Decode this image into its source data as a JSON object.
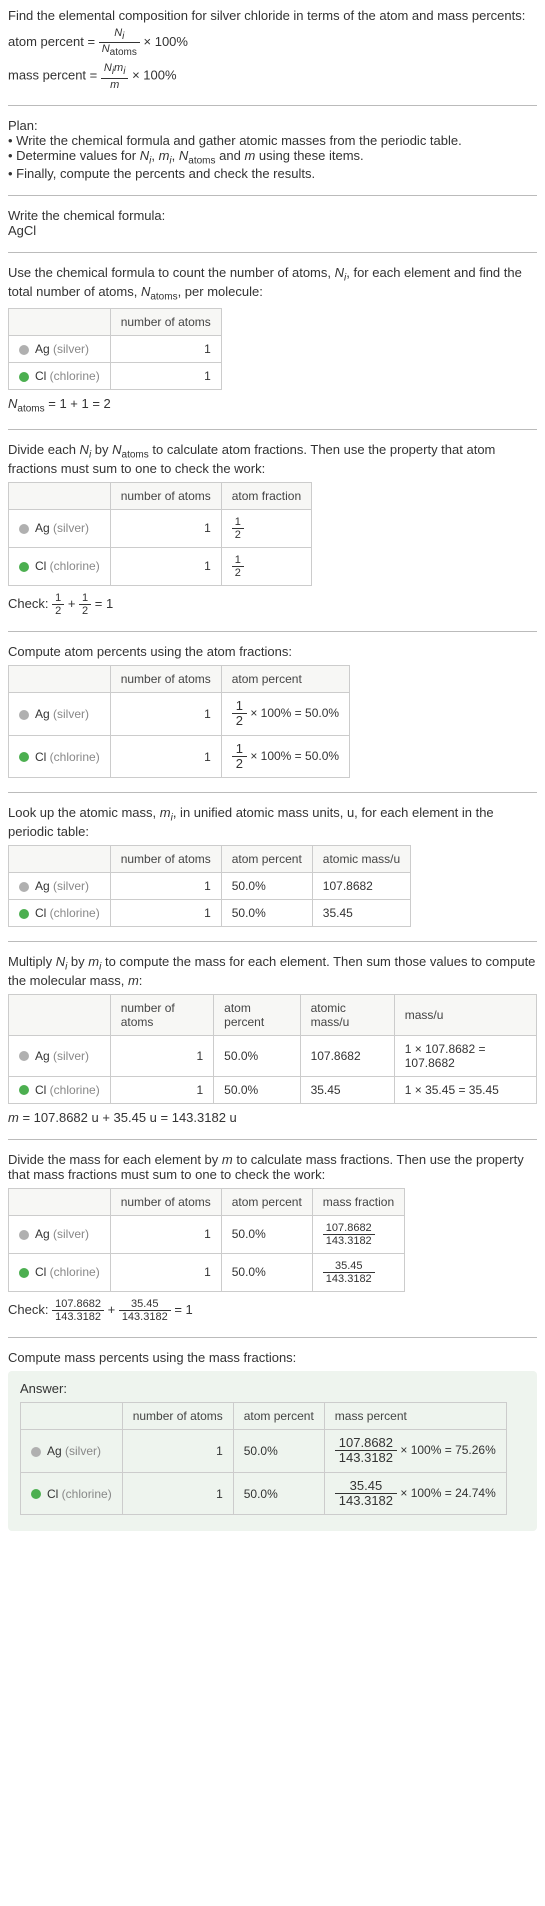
{
  "intro": {
    "prompt": "Find the elemental composition for silver chloride in terms of the atom and mass percents:",
    "atom_percent_lhs": "atom percent = ",
    "atom_percent_num": "N",
    "atom_percent_num_sub": "i",
    "atom_percent_den": "N",
    "atom_percent_den_sub": "atoms",
    "times100": " × 100%",
    "mass_percent_lhs": "mass percent = ",
    "mass_percent_num_a": "N",
    "mass_percent_num_a_sub": "i",
    "mass_percent_num_b": "m",
    "mass_percent_num_b_sub": "i",
    "mass_percent_den": "m"
  },
  "plan": {
    "heading": "Plan:",
    "b1": "• Write the chemical formula and gather atomic masses from the periodic table.",
    "b2_pre": "• Determine values for ",
    "b2_n": "N",
    "b2_ni": "i",
    "b2_m": "m",
    "b2_mi": "i",
    "b2_na": "N",
    "b2_na_sub": "atoms",
    "b2_and": " and ",
    "b2_m2": "m",
    "b2_post": " using these items.",
    "b3": "• Finally, compute the percents and check the results."
  },
  "step_formula": {
    "heading": "Write the chemical formula:",
    "formula": "AgCl"
  },
  "step_count": {
    "text_a": "Use the chemical formula to count the number of atoms, ",
    "n": "N",
    "n_sub": "i",
    "text_b": ", for each element and find the total number of atoms, ",
    "na": "N",
    "na_sub": "atoms",
    "text_c": ", per molecule:",
    "col_num": "number of atoms",
    "ag_label": "Ag",
    "ag_paren": " (silver)",
    "ag_n": "1",
    "cl_label": "Cl",
    "cl_paren": " (chlorine)",
    "cl_n": "1",
    "sum_lhs_a": "N",
    "sum_lhs_sub": "atoms",
    "sum_eq": " = 1 + 1 = 2"
  },
  "step_atomfrac": {
    "text_a": "Divide each ",
    "n": "N",
    "n_sub": "i",
    "text_b": " by ",
    "na": "N",
    "na_sub": "atoms",
    "text_c": " to calculate atom fractions. Then use the property that atom fractions must sum to one to check the work:",
    "col_num": "number of atoms",
    "col_af": "atom fraction",
    "ag_n": "1",
    "ag_frac_num": "1",
    "ag_frac_den": "2",
    "cl_n": "1",
    "cl_frac_num": "1",
    "cl_frac_den": "2",
    "check_pre": "Check: ",
    "check_eq": " = 1"
  },
  "step_atompct": {
    "heading": "Compute atom percents using the atom fractions:",
    "col_num": "number of atoms",
    "col_ap": "atom percent",
    "ag_n": "1",
    "ag_frac_num": "1",
    "ag_frac_den": "2",
    "ag_pct": " × 100% = 50.0%",
    "cl_n": "1",
    "cl_frac_num": "1",
    "cl_frac_den": "2",
    "cl_pct": " × 100% = 50.0%"
  },
  "step_mass_lookup": {
    "text_a": "Look up the atomic mass, ",
    "m": "m",
    "m_sub": "i",
    "text_b": ", in unified atomic mass units, u, for each element in the periodic table:",
    "col_num": "number of atoms",
    "col_ap": "atom percent",
    "col_am": "atomic mass/u",
    "ag_n": "1",
    "ag_ap": "50.0%",
    "ag_am": "107.8682",
    "cl_n": "1",
    "cl_ap": "50.0%",
    "cl_am": "35.45"
  },
  "step_mass_mult": {
    "text_a": "Multiply ",
    "n": "N",
    "n_sub": "i",
    "text_b": " by ",
    "m": "m",
    "m_sub": "i",
    "text_c": " to compute the mass for each element. Then sum those values to compute the molecular mass, ",
    "mm": "m",
    "text_d": ":",
    "col_num": "number of atoms",
    "col_ap": "atom percent",
    "col_am": "atomic mass/u",
    "col_mass": "mass/u",
    "ag_n": "1",
    "ag_ap": "50.0%",
    "ag_am": "107.8682",
    "ag_mass": "1 × 107.8682 = 107.8682",
    "cl_n": "1",
    "cl_ap": "50.0%",
    "cl_am": "35.45",
    "cl_mass": "1 × 35.45 = 35.45",
    "sum_m": "m",
    "sum_eq": " = 107.8682 u + 35.45 u = 143.3182 u"
  },
  "step_massfrac": {
    "text_a": "Divide the mass for each element by ",
    "m": "m",
    "text_b": " to calculate mass fractions. Then use the property that mass fractions must sum to one to check the work:",
    "col_num": "number of atoms",
    "col_ap": "atom percent",
    "col_mf": "mass fraction",
    "ag_n": "1",
    "ag_ap": "50.0%",
    "ag_mf_num": "107.8682",
    "ag_mf_den": "143.3182",
    "cl_n": "1",
    "cl_ap": "50.0%",
    "cl_mf_num": "35.45",
    "cl_mf_den": "143.3182",
    "check_pre": "Check: ",
    "check_plus": " + ",
    "check_eq": " = 1"
  },
  "step_masspct": {
    "heading": "Compute mass percents using the mass fractions:",
    "answer_label": "Answer:",
    "col_num": "number of atoms",
    "col_ap": "atom percent",
    "col_mp": "mass percent",
    "ag_label": "Ag",
    "ag_paren": " (silver)",
    "ag_n": "1",
    "ag_ap": "50.0%",
    "ag_mp_num": "107.8682",
    "ag_mp_den": "143.3182",
    "ag_mp_pct": " × 100% = 75.26%",
    "cl_label": "Cl",
    "cl_paren": " (chlorine)",
    "cl_n": "1",
    "cl_ap": "50.0%",
    "cl_mp_num": "35.45",
    "cl_mp_den": "143.3182",
    "cl_mp_pct": " × 100% = 24.74%"
  },
  "common": {
    "sep_comma": ", "
  }
}
